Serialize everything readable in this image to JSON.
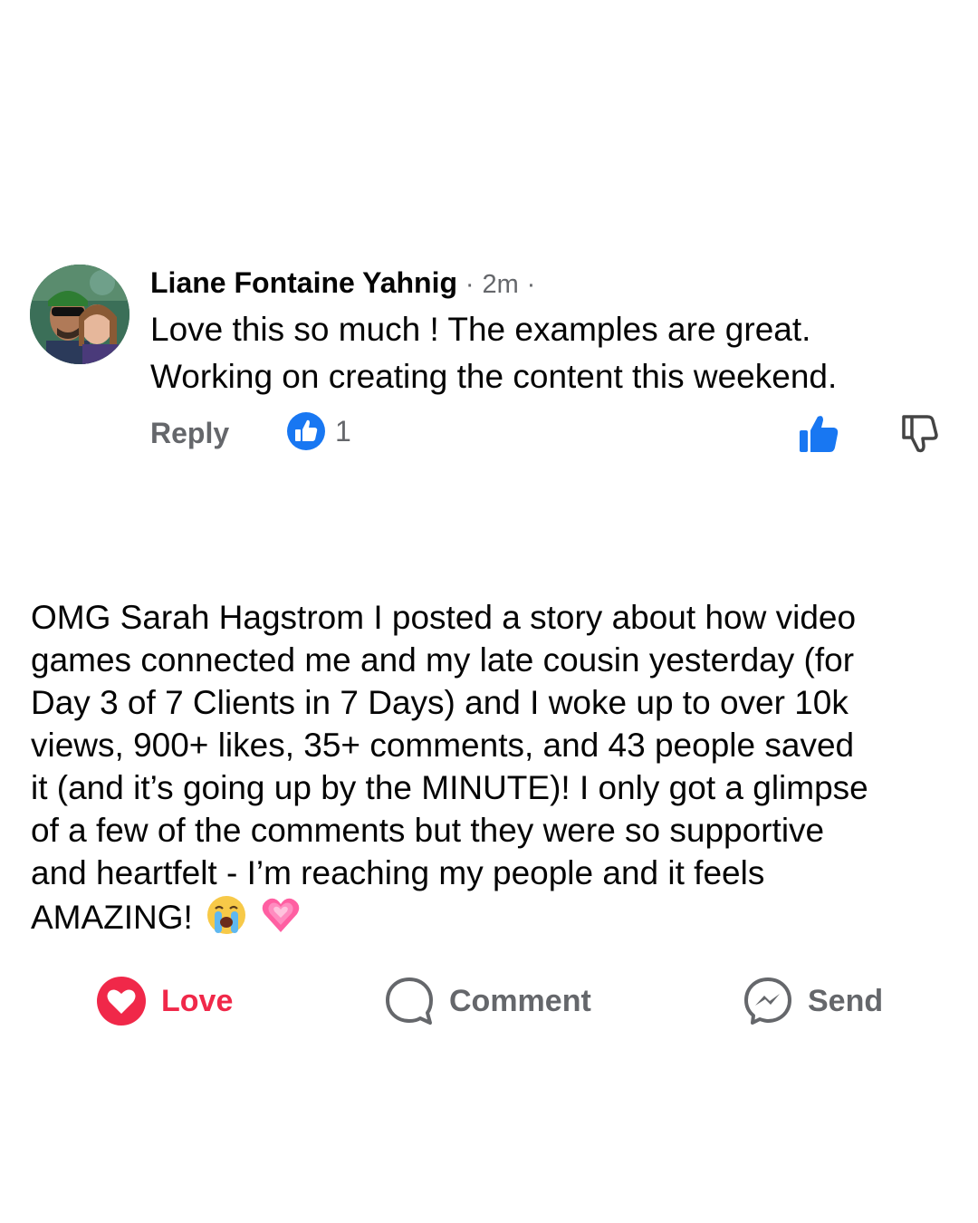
{
  "comment": {
    "author": "Liane Fontaine Yahnig",
    "separator": "·",
    "time": "2m",
    "trailing_separator": "·",
    "text_line1": "Love this so much ! The examples are great.",
    "text_line2": "Working on creating the content this weekend.",
    "reply_label": "Reply",
    "like_count": "1",
    "avatar_icon": "couple-photo-avatar",
    "badge_icon": "like-badge-icon",
    "colors": {
      "like_blue": "#1877f2",
      "meta_gray": "#65676b"
    }
  },
  "post": {
    "lines": [
      "OMG Sarah Hagstrom I posted a story about how video",
      "games connected me and my late cousin yesterday (for",
      "Day 3 of 7 Clients in 7 Days) and I woke up to over 10k",
      "views, 900+ likes, 35+ comments, and 43 people saved",
      "it (and it’s going up by the MINUTE)! I only got a glimpse",
      "of a few of the comments but they were so supportive",
      "and heartfelt - I’m reaching my people and it feels"
    ],
    "last_line": "AMAZING!",
    "emojis": [
      "crying-face-emoji",
      "growing-heart-emoji"
    ]
  },
  "actions": {
    "love_label": "Love",
    "comment_label": "Comment",
    "send_label": "Send",
    "colors": {
      "love_red": "#f02849",
      "label_gray": "#65676b"
    }
  }
}
